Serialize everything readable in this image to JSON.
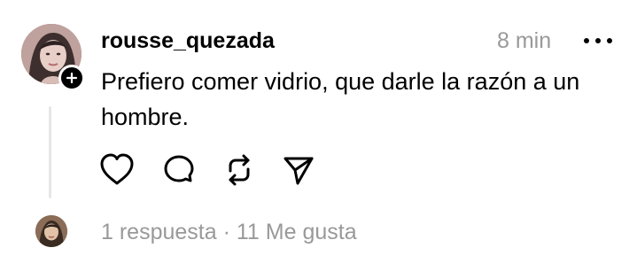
{
  "post": {
    "username": "rousse_quezada",
    "timestamp": "8 min",
    "text": "Prefiero comer vidrio, que darle la razón a un hombre."
  },
  "icons": {
    "more": "more-horizontal-icon",
    "follow": "plus-icon",
    "like": "heart-icon",
    "comment": "comment-icon",
    "repost": "repost-icon",
    "share": "send-icon"
  },
  "footer": {
    "replies": "1 respuesta",
    "separator": "·",
    "likes": "11 Me gusta"
  },
  "colors": {
    "text": "#000000",
    "muted": "#999999",
    "thread_line": "#e6e6e6",
    "background": "#ffffff"
  }
}
